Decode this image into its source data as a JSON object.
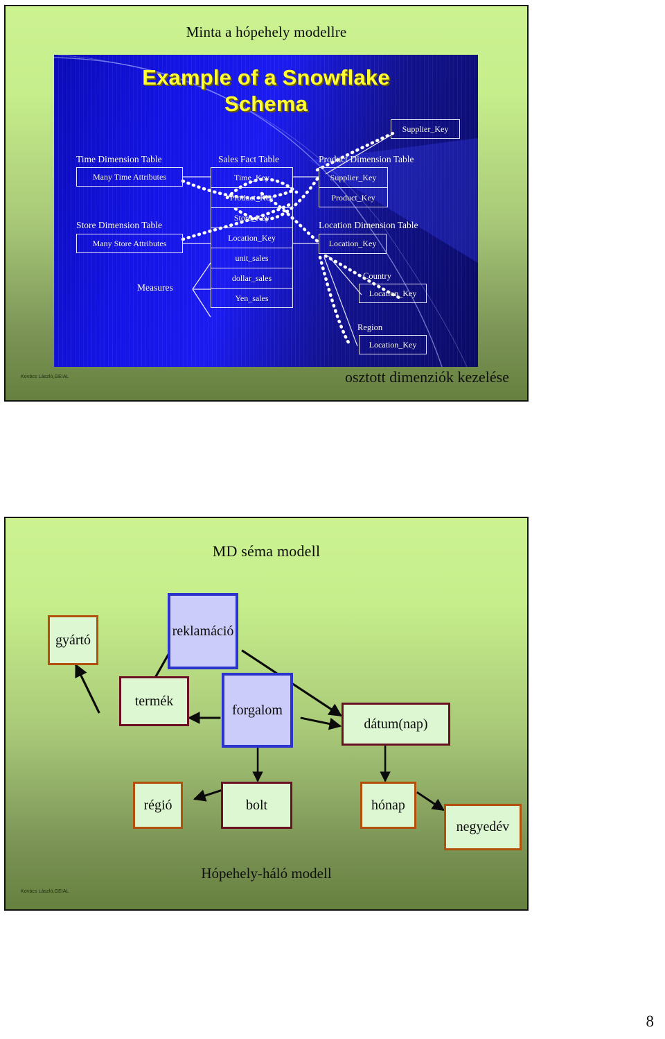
{
  "page": {
    "page_number": "8"
  },
  "slide1": {
    "heading": "Minta a hópehely modellre",
    "snowflake_title_line1": "Example of a Snowflake",
    "snowflake_title_line2": "Schema",
    "footer": "Kovács László,GEIAL",
    "caption": "osztott dimenziók kezelése",
    "labels": {
      "time_dimension_table": "Time Dimension Table",
      "store_dimension_table": "Store Dimension Table",
      "sales_fact_table": "Sales Fact Table",
      "product_dimension_table": "Product Dimension Table",
      "location_dimension_table": "Location Dimension Table",
      "country": "Country",
      "region": "Region",
      "measures": "Measures"
    },
    "time_dimension": {
      "attributes": "Many Time Attributes"
    },
    "store_dimension": {
      "attributes": "Many Store Attributes"
    },
    "fact_table": {
      "rows": [
        "Time_Key",
        "Product_Key",
        "Store_Key",
        "Location_Key",
        "unit_sales",
        "dollar_sales",
        "Yen_sales"
      ]
    },
    "supplier_table": {
      "rows": [
        "Supplier_Key"
      ]
    },
    "product_dimension": {
      "rows": [
        "Supplier_Key",
        "Product_Key"
      ]
    },
    "location_dimension": {
      "rows": [
        "Location_Key"
      ]
    },
    "country_table": {
      "rows": [
        "Location_Key"
      ]
    },
    "region_table": {
      "rows": [
        "Location_Key"
      ]
    }
  },
  "slide2": {
    "heading": "MD séma modell",
    "bottom_caption": "Hópehely-háló modell",
    "footer": "Kovács László,GEIAL",
    "nodes": {
      "gyarto": "gyártó",
      "reklamacio": "reklamáció",
      "termek": "termék",
      "forgalom": "forgalom",
      "datum_nap": "dátum(nap)",
      "regio": "régió",
      "bolt": "bolt",
      "honap": "hónap",
      "negyedev": "negyedév"
    }
  },
  "colors": {
    "slide_bg_top": "#ccf291",
    "slide_bg_bottom": "#66803f",
    "blue_panel": "#1414e8",
    "title_yellow": "#ffff33",
    "dimension_border_orange": "#b3500c",
    "dimension_border_maroon": "#6b1022",
    "fact_border_blue": "#2b33cc",
    "dimension_fill": "#dcf7d2",
    "fact_fill": "#ccccfa"
  }
}
